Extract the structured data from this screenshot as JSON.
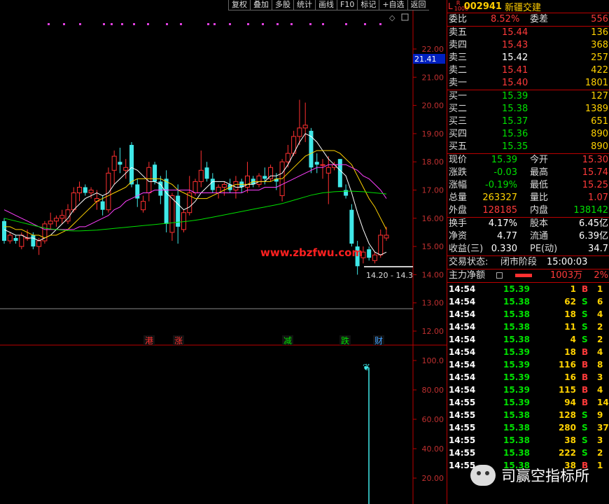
{
  "toolbar": {
    "items": [
      "复权",
      "叠加",
      "多股",
      "统计",
      "画线",
      "F10",
      "标记",
      "+自选",
      "返回"
    ]
  },
  "chart": {
    "price_ticks": [
      "22.00",
      "21.00",
      "20.00",
      "19.00",
      "18.00",
      "17.00",
      "16.00",
      "15.00",
      "14.00",
      "13.00",
      "12.00"
    ],
    "indicator_ticks": [
      "100.0",
      "80.00",
      "60.00",
      "40.00",
      "20.00"
    ],
    "cursor_price": "21.41",
    "range_label": "14.20 - 14.3",
    "watermark": "www.zbzfwu.com",
    "event_markers": [
      "港",
      "涨",
      "减",
      "跌",
      "财"
    ],
    "colors": {
      "up": "#ff3030",
      "down": "#40e8e8",
      "ma5": "#ffffff",
      "ma10": "#ffd200",
      "ma20": "#ff40ff",
      "ma60": "#00e000"
    }
  },
  "chart_data": {
    "type": "candlestick",
    "ylim": [
      12.0,
      22.5
    ],
    "ohlc": [
      [
        15.9,
        16.0,
        15.1,
        15.2
      ],
      [
        15.2,
        15.5,
        15.1,
        15.4
      ],
      [
        15.3,
        15.4,
        15.1,
        15.2
      ],
      [
        15.0,
        15.5,
        14.9,
        15.4
      ],
      [
        15.3,
        15.6,
        15.2,
        15.3
      ],
      [
        15.4,
        15.5,
        14.9,
        15.0
      ],
      [
        15.0,
        15.3,
        14.7,
        15.2
      ],
      [
        15.2,
        15.9,
        15.1,
        15.8
      ],
      [
        15.8,
        16.2,
        15.6,
        15.9
      ],
      [
        15.9,
        16.1,
        15.7,
        16.0
      ],
      [
        16.0,
        16.3,
        15.8,
        16.1
      ],
      [
        15.9,
        16.5,
        15.8,
        16.3
      ],
      [
        16.3,
        17.1,
        16.2,
        16.9
      ],
      [
        16.9,
        17.3,
        16.6,
        17.1
      ],
      [
        17.1,
        17.2,
        16.8,
        16.9
      ],
      [
        16.9,
        17.1,
        16.7,
        17.0
      ],
      [
        16.6,
        17.0,
        16.3,
        16.7
      ],
      [
        16.6,
        16.8,
        16.1,
        16.3
      ],
      [
        16.3,
        17.8,
        16.2,
        17.6
      ],
      [
        17.7,
        18.4,
        17.2,
        18.2
      ],
      [
        18.0,
        18.5,
        17.6,
        17.9
      ],
      [
        17.7,
        18.1,
        17.4,
        17.8
      ],
      [
        18.6,
        18.7,
        17.1,
        17.2
      ],
      [
        17.2,
        17.4,
        16.4,
        16.7
      ],
      [
        16.3,
        16.8,
        16.2,
        16.6
      ],
      [
        16.9,
        18.0,
        16.6,
        17.8
      ],
      [
        17.9,
        18.0,
        17.2,
        17.3
      ],
      [
        17.3,
        17.5,
        16.5,
        16.8
      ],
      [
        17.4,
        17.7,
        15.5,
        15.8
      ],
      [
        15.5,
        16.9,
        15.2,
        16.8
      ],
      [
        16.8,
        17.2,
        15.1,
        15.7
      ],
      [
        15.6,
        16.3,
        15.5,
        16.2
      ],
      [
        16.2,
        17.5,
        16.1,
        16.9
      ],
      [
        16.9,
        17.4,
        16.8,
        17.3
      ],
      [
        17.3,
        18.4,
        17.1,
        17.7
      ],
      [
        17.8,
        18.0,
        17.3,
        17.4
      ],
      [
        17.4,
        17.6,
        16.9,
        17.0
      ],
      [
        16.9,
        17.2,
        16.7,
        17.1
      ],
      [
        17.1,
        17.3,
        16.8,
        17.2
      ],
      [
        17.2,
        17.4,
        16.9,
        17.0
      ],
      [
        17.0,
        17.5,
        16.7,
        17.3
      ],
      [
        17.3,
        17.4,
        16.9,
        17.1
      ],
      [
        17.1,
        18.0,
        16.9,
        17.5
      ],
      [
        17.4,
        17.5,
        17.1,
        17.2
      ],
      [
        17.2,
        17.6,
        17.1,
        17.5
      ],
      [
        17.5,
        17.8,
        17.2,
        17.4
      ],
      [
        17.4,
        17.9,
        17.3,
        17.8
      ],
      [
        17.4,
        17.6,
        17.0,
        17.3
      ],
      [
        16.8,
        18.1,
        16.6,
        18.0
      ],
      [
        18.0,
        18.6,
        17.8,
        18.3
      ],
      [
        18.3,
        19.1,
        18.2,
        18.9
      ],
      [
        18.9,
        20.2,
        18.6,
        19.2
      ],
      [
        19.2,
        20.1,
        18.7,
        19.3
      ],
      [
        19.1,
        19.2,
        17.6,
        17.8
      ],
      [
        18.0,
        18.3,
        17.6,
        17.9
      ],
      [
        17.9,
        18.1,
        17.4,
        17.9
      ],
      [
        17.6,
        18.2,
        16.5,
        17.8
      ],
      [
        17.8,
        18.0,
        17.7,
        17.9
      ],
      [
        18.1,
        18.1,
        17.1,
        17.1
      ],
      [
        17.0,
        17.2,
        16.7,
        16.8
      ],
      [
        16.3,
        16.5,
        15.0,
        15.1
      ],
      [
        15.0,
        15.2,
        14.0,
        14.3
      ],
      [
        14.6,
        15.0,
        14.4,
        14.8
      ],
      [
        14.9,
        15.0,
        14.5,
        14.6
      ],
      [
        14.5,
        14.8,
        14.4,
        14.7
      ],
      [
        14.7,
        15.6,
        14.6,
        15.4
      ],
      [
        15.3,
        15.7,
        15.2,
        15.4
      ]
    ],
    "ma_series": [
      {
        "name": "ma5",
        "values": [
          15.6,
          15.5,
          15.4,
          15.4,
          15.3,
          15.3,
          15.2,
          15.3,
          15.4,
          15.6,
          15.8,
          16.0,
          16.3,
          16.5,
          16.7,
          16.8,
          16.9,
          16.8,
          16.9,
          17.2,
          17.4,
          17.6,
          17.8,
          17.7,
          17.5,
          17.3,
          17.3,
          17.2,
          16.9,
          16.7,
          16.5,
          16.3,
          16.4,
          16.6,
          16.9,
          17.1,
          17.3,
          17.3,
          17.3,
          17.2,
          17.1,
          17.1,
          17.2,
          17.2,
          17.3,
          17.3,
          17.5,
          17.5,
          17.6,
          17.9,
          18.3,
          18.7,
          19.0,
          18.9,
          18.7,
          18.4,
          18.1,
          17.9,
          17.7,
          17.5,
          16.9,
          16.2,
          15.6,
          15.1,
          14.8,
          14.7,
          14.8
        ]
      },
      {
        "name": "ma10",
        "values": [
          15.7,
          15.7,
          15.6,
          15.6,
          15.5,
          15.4,
          15.4,
          15.3,
          15.4,
          15.4,
          15.5,
          15.6,
          15.8,
          16.0,
          16.2,
          16.4,
          16.6,
          16.7,
          16.8,
          16.9,
          17.0,
          17.1,
          17.3,
          17.4,
          17.4,
          17.4,
          17.4,
          17.4,
          17.3,
          17.2,
          17.0,
          16.9,
          16.8,
          16.7,
          16.7,
          16.7,
          16.8,
          16.9,
          17.0,
          17.1,
          17.2,
          17.2,
          17.2,
          17.3,
          17.3,
          17.3,
          17.3,
          17.4,
          17.4,
          17.6,
          17.8,
          18.0,
          18.2,
          18.3,
          18.4,
          18.4,
          18.4,
          18.4,
          18.3,
          18.1,
          17.9,
          17.5,
          17.1,
          16.7,
          16.4,
          16.0,
          15.6
        ]
      },
      {
        "name": "ma20",
        "values": [
          16.3,
          16.2,
          16.1,
          16.0,
          15.9,
          15.8,
          15.7,
          15.6,
          15.6,
          15.6,
          15.6,
          15.6,
          15.6,
          15.7,
          15.7,
          15.8,
          15.9,
          16.0,
          16.1,
          16.3,
          16.4,
          16.6,
          16.7,
          16.8,
          16.9,
          16.9,
          17.0,
          17.0,
          17.0,
          17.0,
          17.0,
          17.0,
          17.0,
          16.9,
          16.9,
          16.9,
          16.9,
          16.9,
          16.9,
          16.9,
          16.9,
          16.9,
          17.0,
          17.0,
          17.0,
          17.1,
          17.1,
          17.1,
          17.2,
          17.3,
          17.4,
          17.5,
          17.6,
          17.7,
          17.8,
          17.8,
          17.9,
          17.9,
          17.9,
          17.9,
          17.8,
          17.7,
          17.5,
          17.4,
          17.2,
          17.0,
          16.7
        ]
      },
      {
        "name": "ma60",
        "values": [
          16.0,
          15.95,
          15.9,
          15.85,
          15.8,
          15.75,
          15.7,
          15.65,
          15.62,
          15.6,
          15.58,
          15.56,
          15.55,
          15.55,
          15.56,
          15.57,
          15.58,
          15.6,
          15.62,
          15.64,
          15.66,
          15.68,
          15.7,
          15.72,
          15.74,
          15.76,
          15.78,
          15.8,
          15.82,
          15.84,
          15.86,
          15.88,
          15.9,
          15.93,
          15.96,
          16.0,
          16.04,
          16.08,
          16.12,
          16.16,
          16.2,
          16.24,
          16.28,
          16.32,
          16.36,
          16.4,
          16.44,
          16.48,
          16.52,
          16.58,
          16.64,
          16.7,
          16.76,
          16.82,
          16.86,
          16.9,
          16.92,
          16.94,
          16.95,
          16.96,
          16.96,
          16.95,
          16.94,
          16.92,
          16.9,
          16.88,
          16.86
        ]
      }
    ]
  },
  "quote": {
    "L": "L",
    "R_top": "R",
    "R_bottom": "1000",
    "code": "002941",
    "name": "新疆交建",
    "weibi_label": "委比",
    "weibi_value": "8.52%",
    "weicha_label": "委差",
    "weicha_value": "556",
    "asks": [
      {
        "label": "卖五",
        "price": "15.44",
        "vol": "136"
      },
      {
        "label": "卖四",
        "price": "15.43",
        "vol": "368"
      },
      {
        "label": "卖三",
        "price": "15.42",
        "vol": "257"
      },
      {
        "label": "卖二",
        "price": "15.41",
        "vol": "422"
      },
      {
        "label": "卖一",
        "price": "15.40",
        "vol": "1801"
      }
    ],
    "bids": [
      {
        "label": "买一",
        "price": "15.39",
        "vol": "127"
      },
      {
        "label": "买二",
        "price": "15.38",
        "vol": "1389"
      },
      {
        "label": "买三",
        "price": "15.37",
        "vol": "651"
      },
      {
        "label": "买四",
        "price": "15.36",
        "vol": "890"
      },
      {
        "label": "买五",
        "price": "15.35",
        "vol": "890"
      }
    ],
    "stats": [
      {
        "l1": "现价",
        "v1": "15.39",
        "c1": "grn",
        "l2": "今开",
        "v2": "15.30",
        "c2": "red"
      },
      {
        "l1": "涨跌",
        "v1": "-0.03",
        "c1": "grn",
        "l2": "最高",
        "v2": "15.74",
        "c2": "red"
      },
      {
        "l1": "涨幅",
        "v1": "-0.19%",
        "c1": "grn",
        "l2": "最低",
        "v2": "15.25",
        "c2": "red"
      },
      {
        "l1": "总量",
        "v1": "263327",
        "c1": "yel",
        "l2": "量比",
        "v2": "1.07",
        "c2": "red"
      },
      {
        "l1": "外盘",
        "v1": "128185",
        "c1": "red",
        "l2": "内盘",
        "v2": "138142",
        "c2": "grn"
      }
    ],
    "stats2": [
      {
        "l1": "换手",
        "v1": "4.17%",
        "l2": "股本",
        "v2": "6.45亿"
      },
      {
        "l1": "净资",
        "v1": "4.77",
        "l2": "流通",
        "v2": "6.39亿"
      },
      {
        "l1": "收益(三)",
        "v1": "0.330",
        "l2": "PE(动)",
        "v2": "34.7"
      }
    ],
    "trade_status_label": "交易状态:",
    "trade_status": "闭市阶段",
    "trade_time": "15:00:03",
    "main_flow_label": "主力净额",
    "main_flow_value": "1003万",
    "main_flow_pct": "2%"
  },
  "ticks": [
    {
      "t": "14:54",
      "p": "15.39",
      "v": "1",
      "bs": "B",
      "n": "1"
    },
    {
      "t": "14:54",
      "p": "15.38",
      "v": "62",
      "bs": "S",
      "n": "6"
    },
    {
      "t": "14:54",
      "p": "15.38",
      "v": "18",
      "bs": "S",
      "n": "4"
    },
    {
      "t": "14:54",
      "p": "15.38",
      "v": "11",
      "bs": "S",
      "n": "2"
    },
    {
      "t": "14:54",
      "p": "15.38",
      "v": "4",
      "bs": "S",
      "n": "2"
    },
    {
      "t": "14:54",
      "p": "15.39",
      "v": "18",
      "bs": "B",
      "n": "4"
    },
    {
      "t": "14:54",
      "p": "15.39",
      "v": "116",
      "bs": "B",
      "n": "8"
    },
    {
      "t": "14:54",
      "p": "15.39",
      "v": "16",
      "bs": "B",
      "n": "3"
    },
    {
      "t": "14:54",
      "p": "15.39",
      "v": "115",
      "bs": "B",
      "n": "4"
    },
    {
      "t": "14:55",
      "p": "15.39",
      "v": "94",
      "bs": "B",
      "n": "14"
    },
    {
      "t": "14:55",
      "p": "15.38",
      "v": "128",
      "bs": "S",
      "n": "9"
    },
    {
      "t": "14:55",
      "p": "15.38",
      "v": "280",
      "bs": "S",
      "n": "37"
    },
    {
      "t": "14:55",
      "p": "15.38",
      "v": "38",
      "bs": "S",
      "n": "3"
    },
    {
      "t": "14:55",
      "p": "15.38",
      "v": "222",
      "bs": "S",
      "n": "2"
    },
    {
      "t": "14:55",
      "p": "15.38",
      "v": "38",
      "bs": "B",
      "n": "1"
    }
  ],
  "watermark_brand": "司赢空指标所"
}
